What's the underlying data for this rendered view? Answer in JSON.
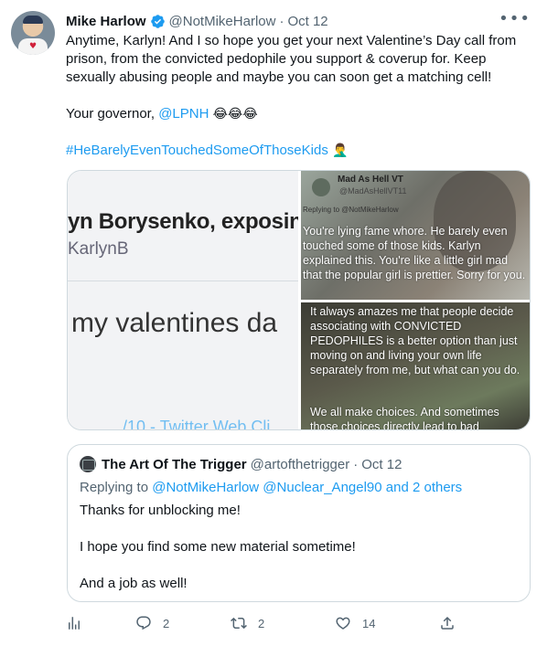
{
  "author": {
    "name": "Mike Harlow",
    "handle": "@NotMikeHarlow",
    "dot": "·",
    "date": "Oct 12"
  },
  "more_icon": "more-horizontal-icon",
  "body": {
    "p1": "Anytime, Karlyn! And I so hope you get your next Valentine’s Day call from prison, from the convicted pedophile you support & coverup for. Keep sexually abusing people and maybe you can soon get a matching cell!",
    "p2_prefix": "Your governor, ",
    "p2_mention": "@LPNH",
    "p2_emojis": "😂😂😂",
    "hashtag": "#HeBarelyEvenTouchedSomeOfThoseKids",
    "hashtag_emoji": "🤦‍♂️"
  },
  "media": {
    "left": {
      "title": "yn Borysenko, exposin",
      "handle": "KarlynB",
      "big_text": "my valentines da",
      "footer": "/10 - Twitter Web Cli"
    },
    "right_top": {
      "name": "Mad As Hell VT",
      "handle": "@MadAsHellVT11",
      "replying": "Replying to @NotMikeHarlow",
      "text": "You're lying fame whore. He barely even touched some of those kids. Karlyn explained this. You're like a little girl mad that the popular girl is prettier. Sorry for you."
    },
    "right_bottom": {
      "text1": "It always amazes me that people decide associating with CONVICTED PEDOPHILES is a better option than just moving on and living your own life separately from me, but what can you do.",
      "text2": "We all make choices. And sometimes those choices directly lead to bad"
    }
  },
  "quote": {
    "name": "The Art Of The Trigger",
    "handle": "@artofthetrigger",
    "dot": "·",
    "date": "Oct 12",
    "replying_prefix": "Replying to ",
    "replying_mentions": "@NotMikeHarlow @Nuclear_Angel90",
    "replying_suffix": " and 2 others",
    "lines": [
      "Thanks for unblocking me!",
      "I hope you find some new material sometime!",
      "And a job as well!"
    ]
  },
  "actions": {
    "analytics_icon": "analytics-icon",
    "reply_count": "2",
    "retweet_count": "2",
    "like_count": "14",
    "share_icon": "share-icon"
  },
  "colors": {
    "accent": "#1d9bf0",
    "text": "#0f1419",
    "secondary": "#536471",
    "border": "#cfd9de"
  }
}
